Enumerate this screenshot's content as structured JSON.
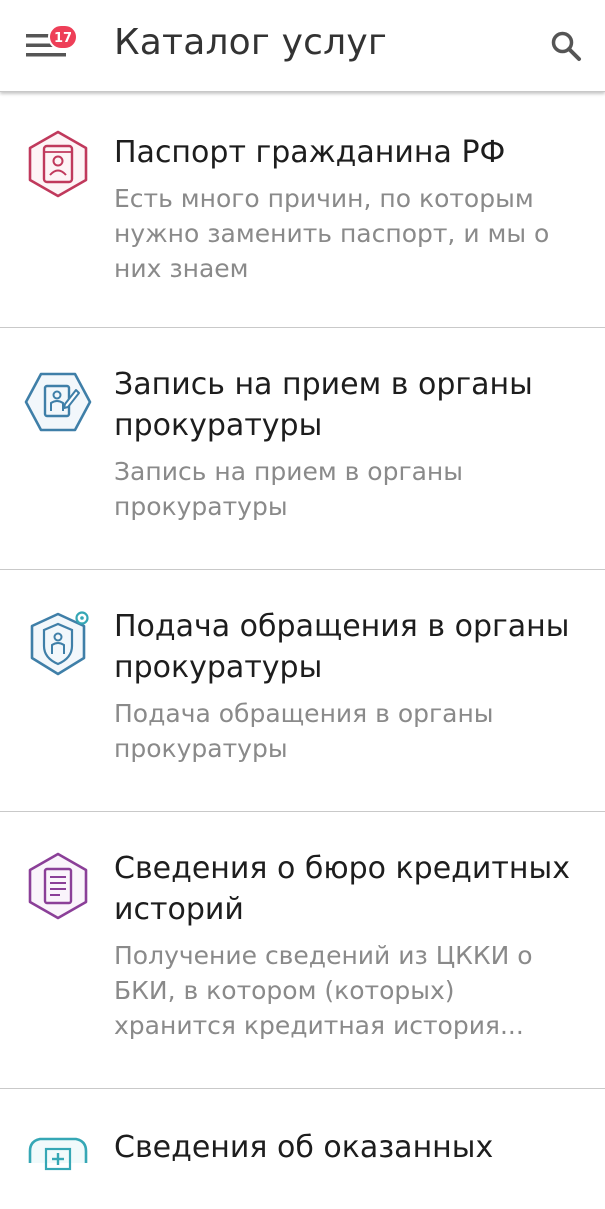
{
  "header": {
    "title": "Каталог услуг",
    "badge_count": "17",
    "menu_icon": "hamburger-icon",
    "search_icon": "search-icon"
  },
  "colors": {
    "badge": "#ee3f58",
    "passport_icon": "#c0395c",
    "prosecutor_icon": "#3f7fa8",
    "credit_icon": "#8b3f98",
    "medical_icon": "#35a7b5",
    "divider": "#c9c9c9",
    "secondary_text": "#8a8a8a"
  },
  "services": [
    {
      "icon": "passport-icon",
      "title": "Паспорт гражданина РФ",
      "description": "Есть много причин, по которым нужно заменить паспорт, и мы о них знаем"
    },
    {
      "icon": "prosecutor-appointment-icon",
      "title": "Запись на прием в органы прокуратуры",
      "description": "Запись на прием в органы прокуратуры"
    },
    {
      "icon": "prosecutor-appeal-icon",
      "title": "Подача обращения в органы прокуратуры",
      "description": "Подача обращения в органы прокуратуры"
    },
    {
      "icon": "credit-history-icon",
      "title": "Сведения о бюро кредитных историй",
      "description": "Получение сведений из ЦККИ о БКИ, в котором (которых) хранится кредитная история..."
    },
    {
      "icon": "medical-services-icon",
      "title": "Сведения об оказанных"
    }
  ]
}
